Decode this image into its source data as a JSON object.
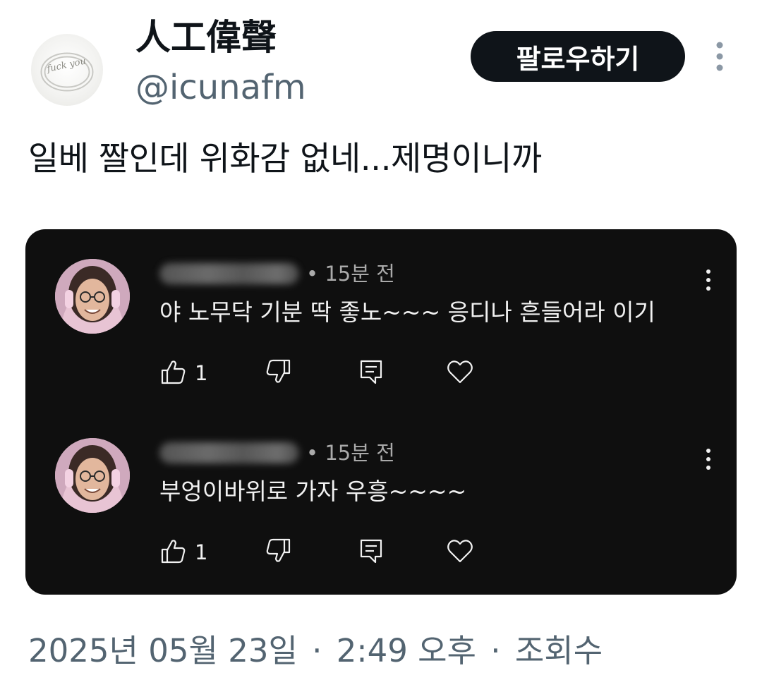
{
  "author": {
    "display_name": "人工偉聲",
    "handle": "@icunafm",
    "avatar_text": "fuck you"
  },
  "follow_button": {
    "label": "팔로우하기"
  },
  "tweet": {
    "text": "일베 짤인데 위화감 없네...제명이니까"
  },
  "media": {
    "comments": [
      {
        "time": "• 15분 전",
        "text": "야 노무닥 기분 딱 좋노~~~ 응디나 흔들어라 이기",
        "likes": "1"
      },
      {
        "time": "• 15분 전",
        "text": "부엉이바위로 가자 우흥~~~~",
        "likes": "1"
      }
    ]
  },
  "meta": {
    "date": "2025년 05월 23일",
    "sep": "·",
    "time": "2:49 오후",
    "views": "조회수"
  },
  "icons": {
    "more": "more-vertical-icon",
    "like": "thumbs-up-icon",
    "dislike": "thumbs-down-icon",
    "reply": "reply-icon",
    "heart": "heart-icon"
  },
  "colors": {
    "text_primary": "#0f1419",
    "text_secondary": "#536471",
    "button_bg": "#0f1419",
    "media_bg": "#0f0f0f"
  }
}
